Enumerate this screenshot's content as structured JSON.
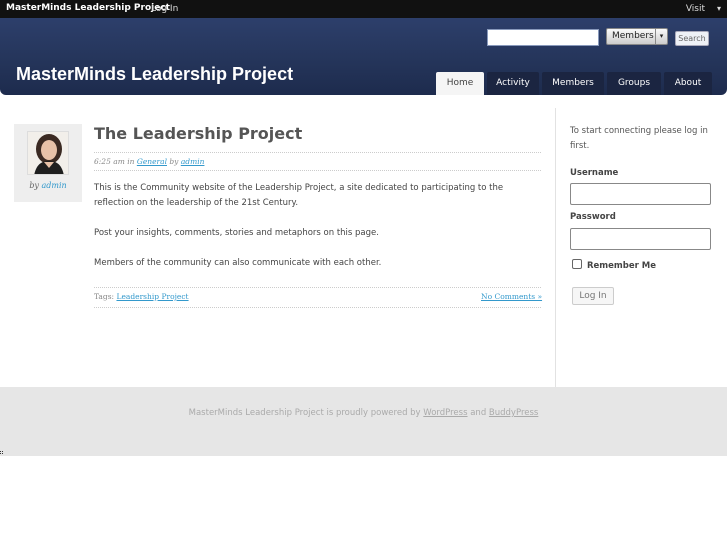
{
  "adminbar": {
    "site_name": "MasterMinds Leadership Project",
    "login_label": "Log In",
    "visit_label": "Visit",
    "visit_caret": "▾"
  },
  "header": {
    "site_title": "MasterMinds Leadership Project",
    "search": {
      "value": "",
      "placeholder": ""
    },
    "search_scope": "Members",
    "search_scope_caret": "▾",
    "search_button": "Search",
    "tabs": [
      {
        "label": "Home",
        "active": true
      },
      {
        "label": "Activity",
        "active": false
      },
      {
        "label": "Members",
        "active": false
      },
      {
        "label": "Groups",
        "active": false
      },
      {
        "label": "About",
        "active": false
      }
    ]
  },
  "post": {
    "author_prefix": "by",
    "author": "admin",
    "title": "The Leadership Project",
    "meta": {
      "time": "6:25 am",
      "in_word": "in",
      "category": "General",
      "by_word": "by",
      "author": "admin"
    },
    "paragraphs": [
      "This is the Community website of the Leadership Project, a site dedicated to participating to the reflection on the leadership of the 21st Century.",
      "Post your insights, comments, stories and metaphors on this page.",
      "Members of the community can also communicate with each other."
    ],
    "tags_label": "Tags:",
    "tag": "Leadership Project",
    "comments_link": "No Comments »"
  },
  "sidebar": {
    "intro": "To start connecting please log in first.",
    "username_label": "Username",
    "username_value": "",
    "password_label": "Password",
    "password_value": "",
    "remember_label": "Remember Me",
    "login_button": "Log In"
  },
  "footer": {
    "text_before": "MasterMinds Leadership Project is proudly powered by",
    "link1": "WordPress",
    "and_word": "and",
    "link2": "BuddyPress"
  },
  "colors": {
    "header_bg": "#243459",
    "tab_bg": "#1b2541",
    "link": "#3399cc",
    "footer_bg": "#e6e6e6"
  }
}
